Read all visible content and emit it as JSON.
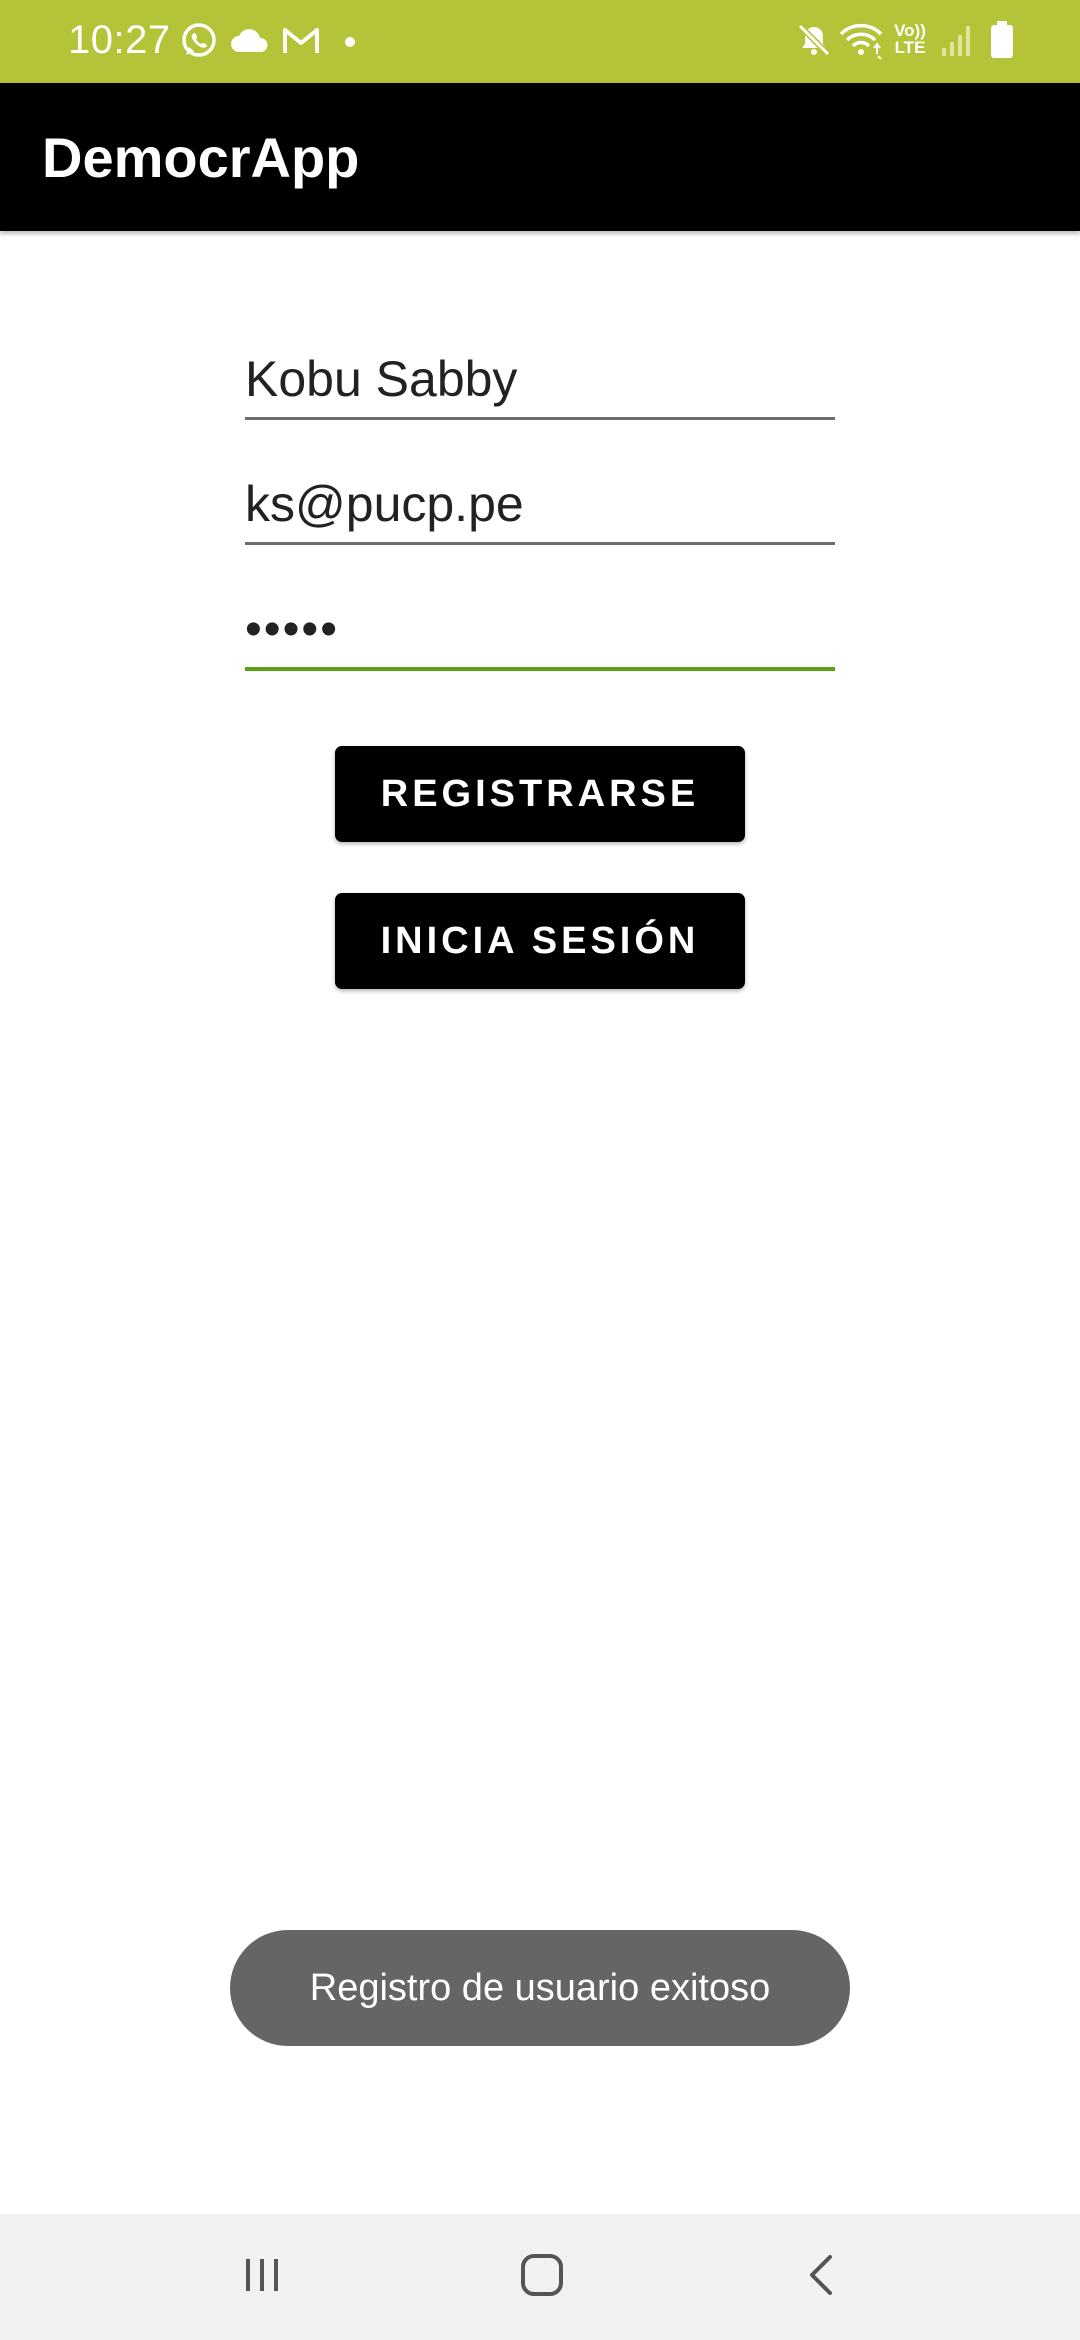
{
  "status_bar": {
    "time": "10:27",
    "left_icons": [
      "whatsapp-icon",
      "cloud-icon",
      "gmail-icon",
      "dot-icon"
    ],
    "right_icons": [
      "mute-icon",
      "wifi-icon",
      "volte-icon",
      "signal-icon",
      "battery-icon"
    ],
    "volte_label_top": "Vo))",
    "volte_label_bottom": "LTE",
    "background_color": "#b4c337"
  },
  "app_bar": {
    "title": "DemocrApp",
    "background_color": "#000000"
  },
  "form": {
    "name_value": "Kobu Sabby",
    "email_value": "ks@pucp.pe",
    "password_value": "•••••",
    "focused_line_color": "#5fa01a"
  },
  "buttons": {
    "register_label": "REGISTRARSE",
    "login_label": "INICIA SESIÓN"
  },
  "toast": {
    "message": "Registro de usuario exitoso"
  },
  "nav_bar": {
    "icons": [
      "recent-apps-icon",
      "home-icon",
      "back-icon"
    ]
  }
}
